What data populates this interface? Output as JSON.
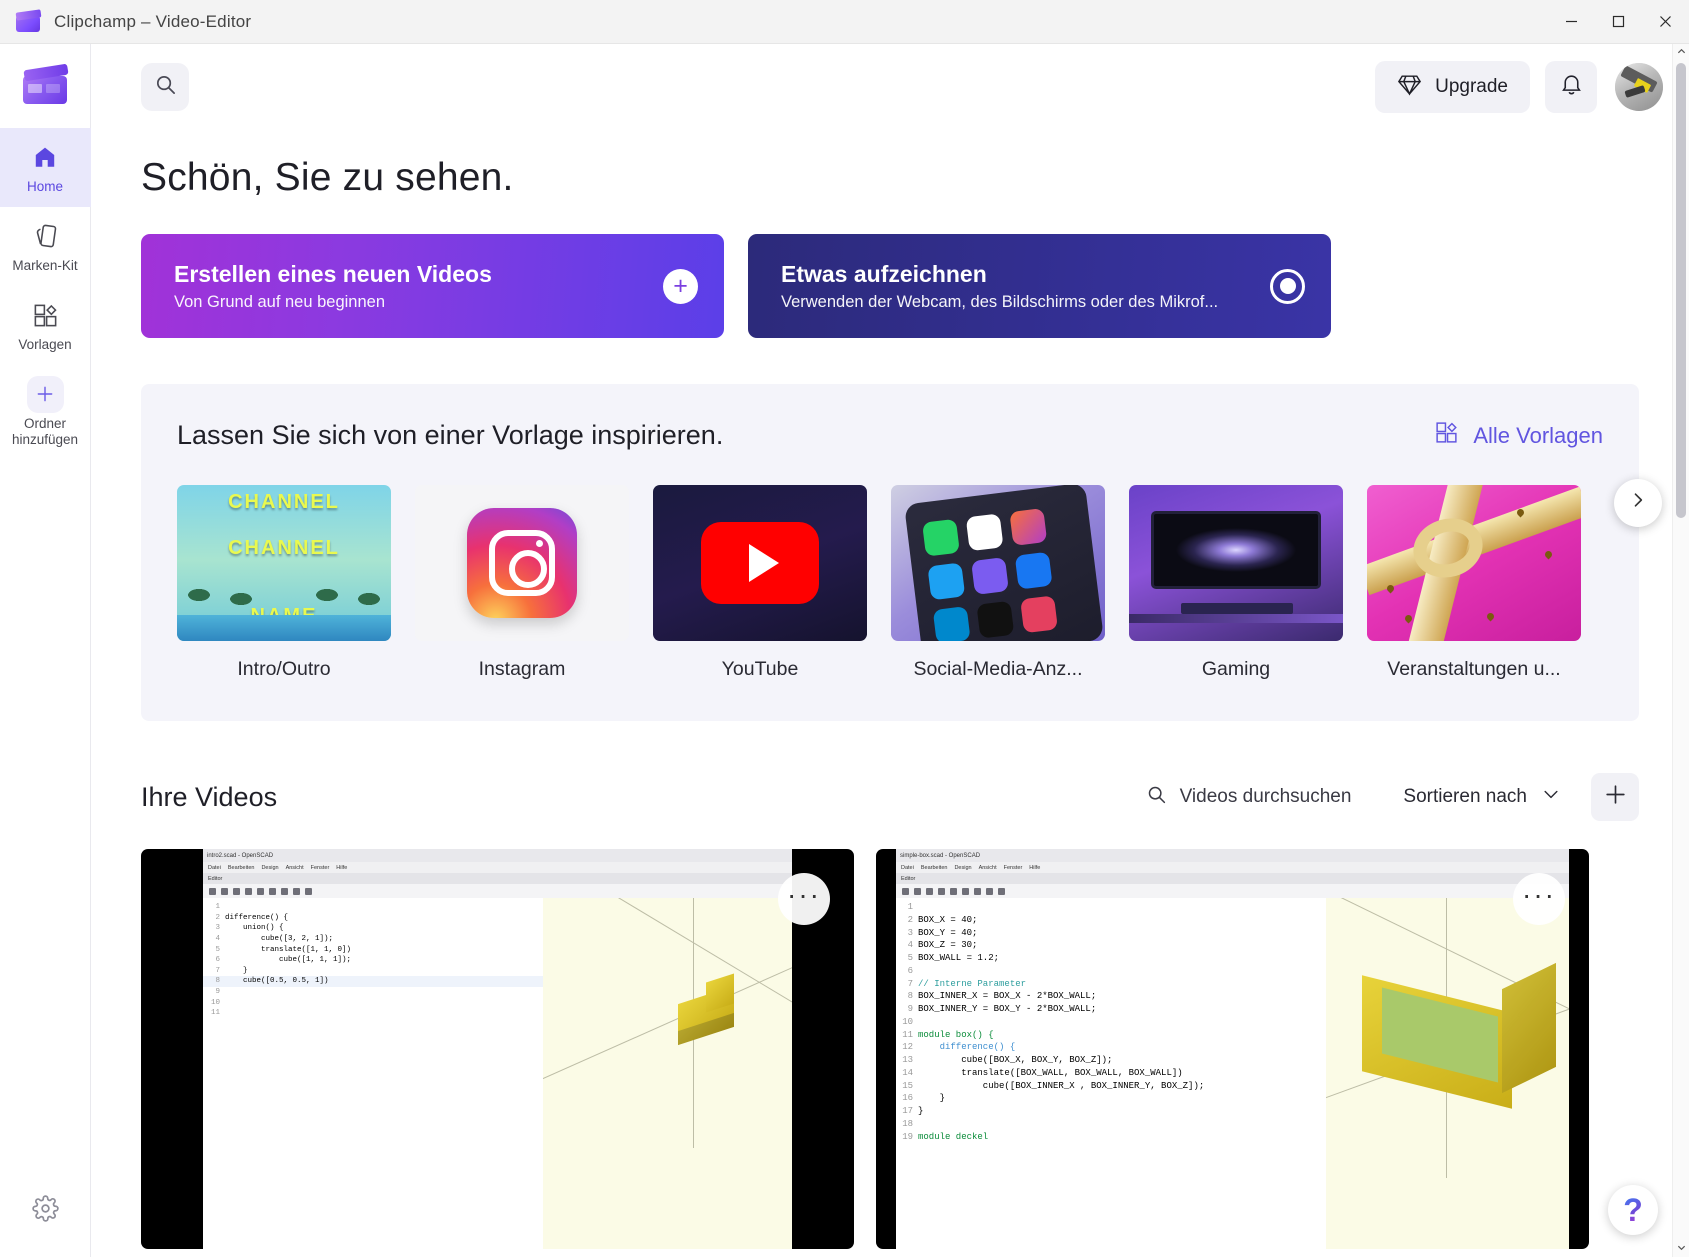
{
  "window": {
    "title": "Clipchamp – Video-Editor",
    "app_icon": "clapperboard-icon",
    "minimize": "–",
    "maximize": "▢",
    "close": "✕"
  },
  "sidebar": {
    "logo_icon": "clipchamp-logo-icon",
    "items": [
      {
        "label": "Home",
        "icon": "home-icon",
        "active": true
      },
      {
        "label": "Marken-Kit",
        "icon": "brand-kit-icon",
        "active": false
      },
      {
        "label": "Vorlagen",
        "icon": "templates-icon",
        "active": false
      },
      {
        "label": "Ordner hinzufügen",
        "icon": "plus-icon",
        "active": false
      }
    ],
    "settings_icon": "gear-icon"
  },
  "header": {
    "search_icon": "search-icon",
    "upgrade_label": "Upgrade",
    "upgrade_icon": "diamond-icon",
    "notifications_icon": "bell-icon",
    "avatar": "user-avatar"
  },
  "main": {
    "greeting": "Schön, Sie zu sehen.",
    "actions": [
      {
        "title": "Erstellen eines neuen Videos",
        "subtitle": "Von Grund auf neu beginnen",
        "icon": "plus-circle-icon"
      },
      {
        "title": "Etwas aufzeichnen",
        "subtitle": "Verwenden der Webcam, des Bildschirms oder des Mikrof...",
        "icon": "record-circle-icon"
      }
    ],
    "templates": {
      "heading": "Lassen Sie sich von einer Vorlage inspirieren.",
      "all_link": "Alle Vorlagen",
      "all_link_icon": "templates-icon",
      "next_icon": "chevron-right-icon",
      "cards": [
        {
          "label": "Intro/Outro",
          "art": "intro",
          "text_lines": [
            "CHANNEL",
            "CHANNEL",
            "NAME"
          ]
        },
        {
          "label": "Instagram",
          "art": "instagram"
        },
        {
          "label": "YouTube",
          "art": "youtube"
        },
        {
          "label": "Social-Media-Anz...",
          "art": "socialmedia"
        },
        {
          "label": "Gaming",
          "art": "gaming"
        },
        {
          "label": "Veranstaltungen u...",
          "art": "events"
        }
      ]
    },
    "videos": {
      "heading": "Ihre Videos",
      "search_placeholder": "Videos durchsuchen",
      "search_icon": "search-icon",
      "sort_label": "Sortieren nach",
      "sort_icon": "chevron-down-icon",
      "add_icon": "plus-icon",
      "menu_icon": "more-options-icon",
      "items": [
        {
          "window_title": "intro2.scad - OpenSCAD",
          "menus": [
            "Datei",
            "Bearbeiten",
            "Design",
            "Ansicht",
            "Fenster",
            "Hilfe"
          ],
          "tab": "Editor",
          "code": [
            {
              "n": "1",
              "t": ""
            },
            {
              "n": "2",
              "t": "difference() {"
            },
            {
              "n": "3",
              "t": "    union() {"
            },
            {
              "n": "4",
              "t": "        cube([3, 2, 1]);"
            },
            {
              "n": "5",
              "t": "        translate([1, 1, 0])"
            },
            {
              "n": "6",
              "t": "            cube([1, 1, 1]);"
            },
            {
              "n": "7",
              "t": "    }"
            },
            {
              "n": "8",
              "t": "    cube([0.5, 0.5, 1])"
            },
            {
              "n": "9",
              "t": ""
            },
            {
              "n": "10",
              "t": ""
            },
            {
              "n": "11",
              "t": ""
            }
          ]
        },
        {
          "window_title": "simple-box.scad - OpenSCAD",
          "menus": [
            "Datei",
            "Bearbeiten",
            "Design",
            "Ansicht",
            "Fenster",
            "Hilfe"
          ],
          "tab": "Editor",
          "code": [
            {
              "n": "1",
              "t": ""
            },
            {
              "n": "2",
              "t": "BOX_X = 40;"
            },
            {
              "n": "3",
              "t": "BOX_Y = 40;"
            },
            {
              "n": "4",
              "t": "BOX_Z = 30;"
            },
            {
              "n": "5",
              "t": "BOX_WALL = 1.2;"
            },
            {
              "n": "6",
              "t": ""
            },
            {
              "n": "7",
              "t": "// Interne Parameter"
            },
            {
              "n": "8",
              "t": "BOX_INNER_X = BOX_X - 2*BOX_WALL;"
            },
            {
              "n": "9",
              "t": "BOX_INNER_Y = BOX_Y - 2*BOX_WALL;"
            },
            {
              "n": "10",
              "t": ""
            },
            {
              "n": "11",
              "t": "module box() {"
            },
            {
              "n": "12",
              "t": "    difference() {"
            },
            {
              "n": "13",
              "t": "        cube([BOX_X, BOX_Y, BOX_Z]);"
            },
            {
              "n": "14",
              "t": "        translate([BOX_WALL, BOX_WALL, BOX_WALL])"
            },
            {
              "n": "15",
              "t": "            cube([BOX_INNER_X , BOX_INNER_Y, BOX_Z]);"
            },
            {
              "n": "16",
              "t": "    }"
            },
            {
              "n": "17",
              "t": "}"
            },
            {
              "n": "18",
              "t": ""
            },
            {
              "n": "19",
              "t": "module deckel"
            }
          ]
        }
      ]
    }
  },
  "help": {
    "label": "?",
    "icon": "help-icon"
  },
  "scrollbar": {
    "up_icon": "chevron-up-icon",
    "down_icon": "chevron-down-icon"
  },
  "colors": {
    "accent": "#6155e0",
    "create_card": "#8b3ae0",
    "record_card": "#332f93",
    "panel_bg": "#f4f4fa"
  }
}
